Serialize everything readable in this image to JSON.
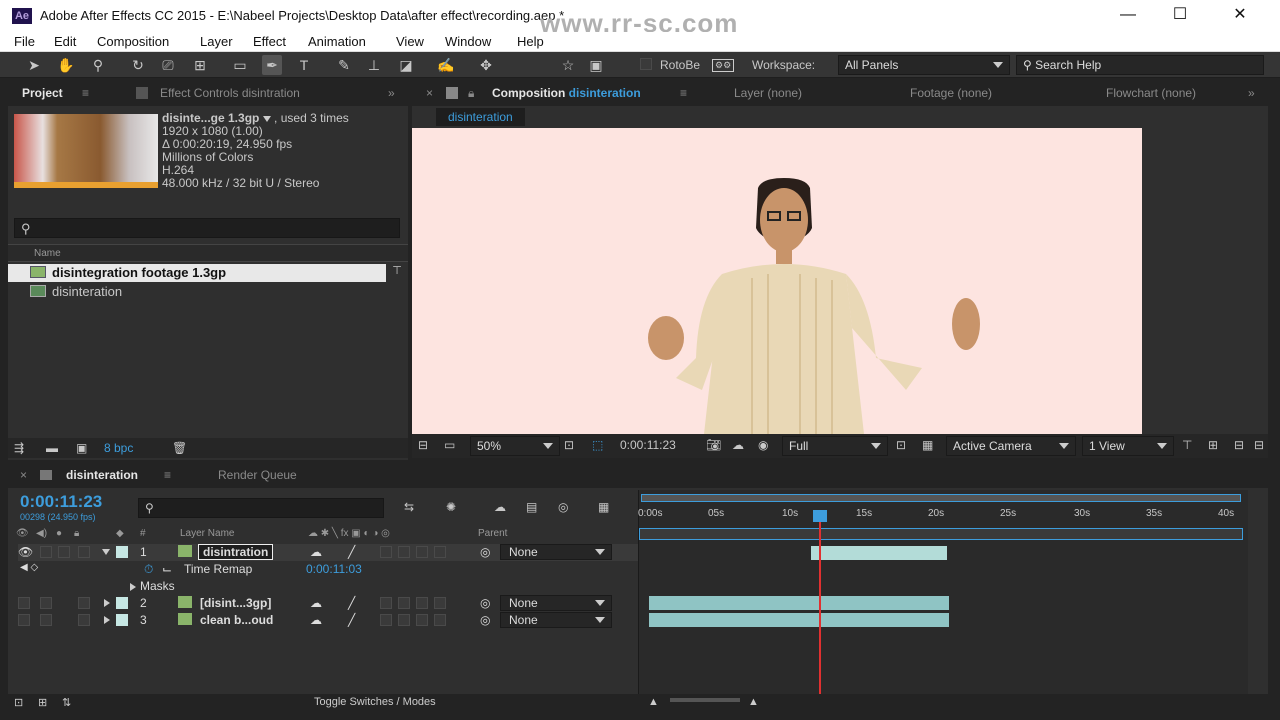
{
  "window": {
    "app_badge": "Ae",
    "title": "Adobe After Effects CC 2015 - E:\\Nabeel Projects\\Desktop Data\\after effect\\recording.aep *",
    "watermark": "www.rr-sc.com"
  },
  "menu": [
    "File",
    "Edit",
    "Composition",
    "Layer",
    "Effect",
    "Animation",
    "View",
    "Window",
    "Help"
  ],
  "toolbar": {
    "rotobe_label": "RotoBe",
    "workspace_label": "Workspace:",
    "workspace_value": "All Panels",
    "search_help": "Search Help"
  },
  "project_panel": {
    "tab_project": "Project",
    "tab_effect_controls": "Effect Controls disintration",
    "file_name": "disinte...ge 1.3gp",
    "used": ", used 3 times",
    "resolution": "1920 x 1080 (1.00)",
    "duration": "Δ 0:00:20:19, 24.950 fps",
    "colors": "Millions of Colors",
    "codec": "H.264",
    "audio": "48.000 kHz / 32 bit U / Stereo",
    "search_placeholder": "",
    "col_name": "Name",
    "items": [
      {
        "label": "disintegration footage 1.3gp"
      },
      {
        "label": "disinteration"
      }
    ],
    "bpc": "8 bpc"
  },
  "comp_panel": {
    "tab_prefix": "Composition",
    "tab_name": "disinteration",
    "tab_layer": "Layer (none)",
    "tab_footage": "Footage (none)",
    "tab_flowchart": "Flowchart (none)",
    "crumb": "disinteration",
    "zoom": "50%",
    "timecode": "0:00:11:23",
    "resolution": "Full",
    "camera": "Active Camera",
    "views": "1 View"
  },
  "timeline": {
    "tab_comp": "disinteration",
    "tab_render": "Render Queue",
    "timecode": "0:00:11:23",
    "frame_info": "00298 (24.950 fps)",
    "col_layer_name": "Layer Name",
    "col_parent": "Parent",
    "col_num": "#",
    "layers": [
      {
        "num": "1",
        "name": "disintration",
        "parent": "None"
      },
      {
        "num": "2",
        "name": "[disint...3gp]",
        "parent": "None"
      },
      {
        "num": "3",
        "name": "clean b...oud",
        "parent": "None"
      }
    ],
    "time_remap_label": "Time Remap",
    "time_remap_value": "0:00:11:03",
    "masks_label": "Masks",
    "ruler": [
      "0:00s",
      "05s",
      "10s",
      "15s",
      "20s",
      "25s",
      "30s",
      "35s",
      "40s"
    ],
    "toggle_label": "Toggle Switches / Modes"
  },
  "colors": {
    "accent": "#3d9ddc",
    "comp_bg": "#fde4e0",
    "layer_label": "#c6e7e3",
    "playhead": "#e03030"
  }
}
